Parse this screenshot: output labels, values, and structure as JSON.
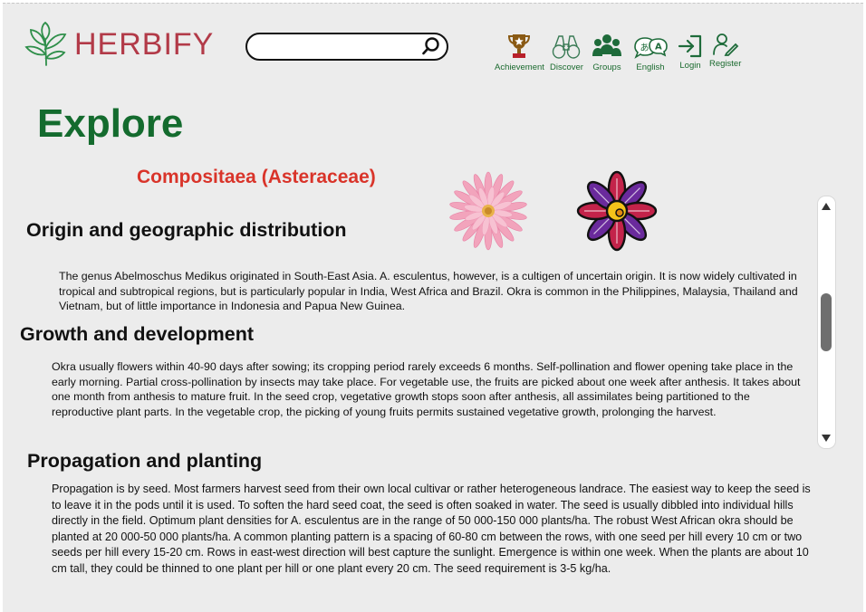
{
  "brand": {
    "name": "HERBIFY"
  },
  "search": {
    "placeholder": "",
    "value": ""
  },
  "nav": [
    {
      "label": "Achievement",
      "icon": "trophy-icon"
    },
    {
      "label": "Discover",
      "icon": "binoculars-icon"
    },
    {
      "label": "Groups",
      "icon": "groups-icon"
    },
    {
      "label": "English",
      "icon": "language-icon"
    },
    {
      "label": "Login",
      "icon": "login-icon"
    },
    {
      "label": "Register",
      "icon": "register-icon"
    }
  ],
  "page": {
    "title": "Explore",
    "family": "Compositaea (Asteraceae)"
  },
  "sections": [
    {
      "heading": "Origin and geographic distribution",
      "text": "The genus Abelmoschus Medikus originated in South-East Asia. A. esculentus, however, is a cultigen of uncertain origin. It is now widely cultivated in tropical and subtropical regions, but is particularly popular in India, West Africa and Brazil. Okra is common in the Philippines, Malaysia, Thailand and Vietnam, but of little importance in Indonesia and Papua New Guinea."
    },
    {
      "heading": "Growth and development",
      "text": "Okra usually flowers within 40-90 days after sowing; its cropping period rarely exceeds 6 months. Self-pollination and flower opening take place in the early morning. Partial cross-pollination by insects may take place. For vegetable use, the fruits are picked about one week after anthesis. It takes about one month from anthesis to mature fruit. In the seed crop, vegetative growth stops soon after anthesis, all assimilates being partitioned to the reproductive plant parts. In the vegetable crop, the picking of young fruits permits sustained vegetative growth, prolonging the harvest."
    },
    {
      "heading": "Propagation and planting",
      "text": "Propagation is by seed. Most farmers harvest seed from their own local cultivar or rather heterogeneous landrace. The easiest way to keep the seed is to leave it in the pods until it is used. To soften the hard seed coat, the seed is often soaked in water. The seed is usually dibbled into individual hills directly in the field. Optimum plant densities for A. esculentus are in the range of 50 000-150 000 plants/ha. The robust West African okra should be planted at 20 000-50 000 plants/ha. A common planting pattern is a spacing of 60-80 cm between the rows, with one seed per hill every 10 cm or two seeds per hill every 15-20 cm. Rows in east-west direction will best capture the sunlight. Emergence is within one week. When the plants are about 10 cm tall, they could be thinned to one plant per hill or one plant every 20 cm. The seed requirement is 3-5 kg/ha."
    }
  ],
  "colors": {
    "brand": "#b23a48",
    "accent_green": "#146b2e",
    "family_red": "#d9342a"
  }
}
